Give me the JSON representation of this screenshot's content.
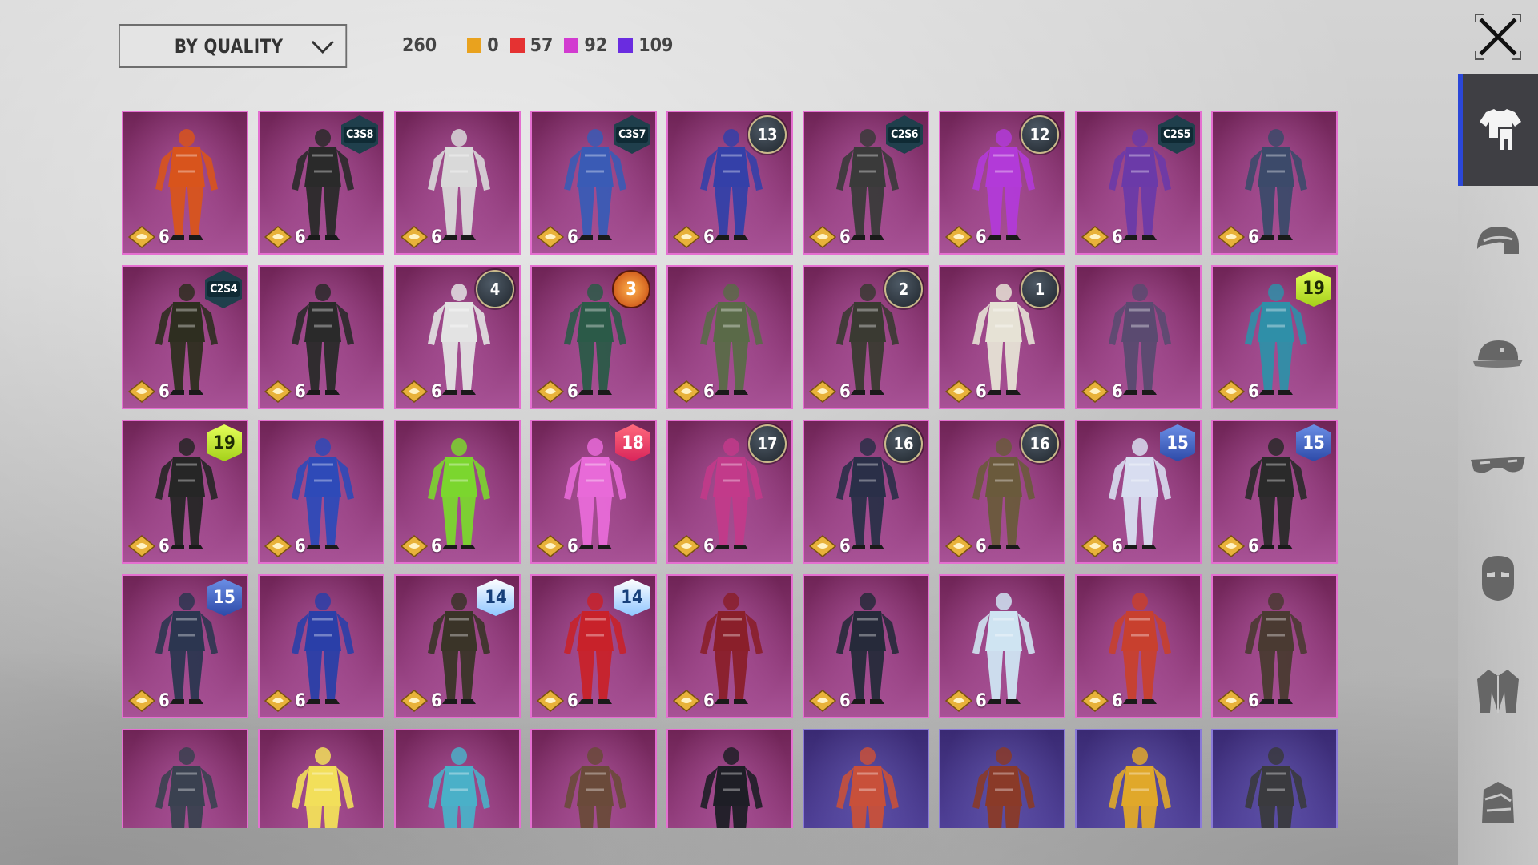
{
  "sort": {
    "label": "BY QUALITY"
  },
  "stats": {
    "total": "260",
    "counts": [
      {
        "value": "0",
        "color": "#e9a21e"
      },
      {
        "value": "57",
        "color": "#e53232"
      },
      {
        "value": "92",
        "color": "#d23bd0"
      },
      {
        "value": "109",
        "color": "#6a2ce0"
      }
    ]
  },
  "rail": {
    "tabs": [
      {
        "icon": "outfit-icon",
        "active": true
      },
      {
        "icon": "helmet-icon",
        "active": false
      },
      {
        "icon": "cap-icon",
        "active": false
      },
      {
        "icon": "goggles-icon",
        "active": false
      },
      {
        "icon": "mask-icon",
        "active": false
      },
      {
        "icon": "jacket-icon",
        "active": false
      },
      {
        "icon": "backpack-icon",
        "active": false
      }
    ]
  },
  "items": [
    {
      "cost": "6",
      "badge": "",
      "badge_style": "",
      "rarity": "legendary",
      "tint": "#d8541c"
    },
    {
      "cost": "6",
      "badge": "C3S8",
      "badge_style": "hex",
      "rarity": "legendary",
      "tint": "#2a2a2a"
    },
    {
      "cost": "6",
      "badge": "",
      "badge_style": "",
      "rarity": "legendary",
      "tint": "#d9d9d9"
    },
    {
      "cost": "6",
      "badge": "C3S7",
      "badge_style": "hex",
      "rarity": "legendary",
      "tint": "#3a5bb5"
    },
    {
      "cost": "6",
      "badge": "13",
      "badge_style": "season",
      "rarity": "legendary",
      "tint": "#3440a8"
    },
    {
      "cost": "6",
      "badge": "C2S6",
      "badge_style": "hex",
      "rarity": "legendary",
      "tint": "#3a3a3a"
    },
    {
      "cost": "6",
      "badge": "12",
      "badge_style": "season",
      "rarity": "legendary",
      "tint": "#b23ad8"
    },
    {
      "cost": "6",
      "badge": "C2S5",
      "badge_style": "hex",
      "rarity": "legendary",
      "tint": "#6b3aa8"
    },
    {
      "cost": "6",
      "badge": "",
      "badge_style": "",
      "rarity": "legendary",
      "tint": "#3c4a6a"
    },
    {
      "cost": "6",
      "badge": "C2S4",
      "badge_style": "hex",
      "rarity": "legendary",
      "tint": "#2e2e20"
    },
    {
      "cost": "6",
      "badge": "",
      "badge_style": "",
      "rarity": "legendary",
      "tint": "#2a2a2a"
    },
    {
      "cost": "6",
      "badge": "4",
      "badge_style": "season",
      "rarity": "legendary",
      "tint": "#e3e3e3"
    },
    {
      "cost": "6",
      "badge": "3",
      "badge_style": "ember",
      "rarity": "legendary",
      "tint": "#2b5a48"
    },
    {
      "cost": "6",
      "badge": "",
      "badge_style": "",
      "rarity": "legendary",
      "tint": "#5a6a48"
    },
    {
      "cost": "6",
      "badge": "2",
      "badge_style": "season",
      "rarity": "legendary",
      "tint": "#3a3a32"
    },
    {
      "cost": "6",
      "badge": "1",
      "badge_style": "season",
      "rarity": "legendary",
      "tint": "#e6e2d5"
    },
    {
      "cost": "6",
      "badge": "",
      "badge_style": "",
      "rarity": "legendary",
      "tint": "#5a4a70"
    },
    {
      "cost": "6",
      "badge": "19",
      "badge_style": "lime",
      "rarity": "legendary",
      "tint": "#2f8fa8"
    },
    {
      "cost": "6",
      "badge": "19",
      "badge_style": "lime",
      "rarity": "legendary",
      "tint": "#262626"
    },
    {
      "cost": "6",
      "badge": "",
      "badge_style": "",
      "rarity": "legendary",
      "tint": "#2e4ab8"
    },
    {
      "cost": "6",
      "badge": "",
      "badge_style": "",
      "rarity": "legendary",
      "tint": "#7bd62e"
    },
    {
      "cost": "6",
      "badge": "18",
      "badge_style": "hot",
      "rarity": "legendary",
      "tint": "#e86ad8"
    },
    {
      "cost": "6",
      "badge": "17",
      "badge_style": "season",
      "rarity": "legendary",
      "tint": "#c23a8a"
    },
    {
      "cost": "6",
      "badge": "16",
      "badge_style": "season",
      "rarity": "legendary",
      "tint": "#2a2f48"
    },
    {
      "cost": "6",
      "badge": "16",
      "badge_style": "season",
      "rarity": "legendary",
      "tint": "#6a5a3c"
    },
    {
      "cost": "6",
      "badge": "15",
      "badge_style": "navy",
      "rarity": "legendary",
      "tint": "#d8ddf0"
    },
    {
      "cost": "6",
      "badge": "15",
      "badge_style": "navy",
      "rarity": "legendary",
      "tint": "#2a2a2a"
    },
    {
      "cost": "6",
      "badge": "15",
      "badge_style": "navy",
      "rarity": "legendary",
      "tint": "#2c3650"
    },
    {
      "cost": "6",
      "badge": "",
      "badge_style": "",
      "rarity": "legendary",
      "tint": "#2a3fa8"
    },
    {
      "cost": "6",
      "badge": "14",
      "badge_style": "sky",
      "rarity": "legendary",
      "tint": "#3a3428"
    },
    {
      "cost": "6",
      "badge": "14",
      "badge_style": "sky",
      "rarity": "legendary",
      "tint": "#c8222a"
    },
    {
      "cost": "6",
      "badge": "",
      "badge_style": "",
      "rarity": "legendary",
      "tint": "#8a1f2a"
    },
    {
      "cost": "6",
      "badge": "",
      "badge_style": "",
      "rarity": "legendary",
      "tint": "#262a3a"
    },
    {
      "cost": "6",
      "badge": "",
      "badge_style": "",
      "rarity": "legendary",
      "tint": "#cfe4f2"
    },
    {
      "cost": "6",
      "badge": "",
      "badge_style": "",
      "rarity": "legendary",
      "tint": "#c8402e"
    },
    {
      "cost": "6",
      "badge": "",
      "badge_style": "",
      "rarity": "legendary",
      "tint": "#4a3a32"
    },
    {
      "cost": "",
      "badge": "",
      "badge_style": "",
      "rarity": "legendary",
      "tint": "#3a4150"
    },
    {
      "cost": "",
      "badge": "",
      "badge_style": "",
      "rarity": "legendary",
      "tint": "#f2df5a"
    },
    {
      "cost": "",
      "badge": "",
      "badge_style": "",
      "rarity": "legendary",
      "tint": "#4ab0c8"
    },
    {
      "cost": "",
      "badge": "",
      "badge_style": "",
      "rarity": "legendary",
      "tint": "#6a4a3a"
    },
    {
      "cost": "",
      "badge": "",
      "badge_style": "",
      "rarity": "legendary",
      "tint": "#1e1e26"
    },
    {
      "cost": "",
      "badge": "",
      "badge_style": "",
      "rarity": "epic",
      "tint": "#c8503a"
    },
    {
      "cost": "",
      "badge": "",
      "badge_style": "",
      "rarity": "epic",
      "tint": "#8a3a28"
    },
    {
      "cost": "",
      "badge": "",
      "badge_style": "",
      "rarity": "epic",
      "tint": "#e0a82a"
    },
    {
      "cost": "",
      "badge": "",
      "badge_style": "",
      "rarity": "epic",
      "tint": "#3a3a3e"
    }
  ]
}
